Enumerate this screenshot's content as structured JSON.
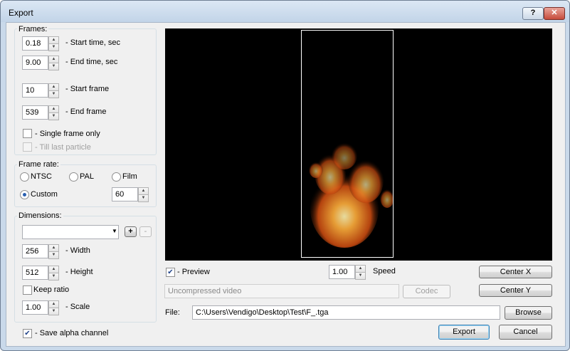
{
  "window": {
    "title": "Export",
    "help_label": "?",
    "close_label": "✕"
  },
  "frames": {
    "legend": "Frames:",
    "start_time": {
      "value": "0.18",
      "label": "- Start time, sec"
    },
    "end_time": {
      "value": "9.00",
      "label": "- End time, sec"
    },
    "start_frame": {
      "value": "10",
      "label": "- Start frame"
    },
    "end_frame": {
      "value": "539",
      "label": "- End frame"
    },
    "single_frame": {
      "label": "- Single frame only",
      "checked": false
    },
    "till_last": {
      "label": "- Till last particle",
      "checked": false,
      "disabled": true
    }
  },
  "frame_rate": {
    "legend": "Frame rate:",
    "options": [
      "NTSC",
      "PAL",
      "Film",
      "Custom"
    ],
    "selected": "Custom",
    "custom_value": "60"
  },
  "dimensions": {
    "legend": "Dimensions:",
    "preset_value": "",
    "add_label": "+",
    "remove_label": "-",
    "width": {
      "value": "256",
      "label": "- Width"
    },
    "height": {
      "value": "512",
      "label": "- Height"
    },
    "keep_ratio": {
      "label": "Keep ratio",
      "checked": false
    },
    "scale": {
      "value": "1.00",
      "label": "- Scale"
    }
  },
  "save_alpha": {
    "label": "- Save alpha channel",
    "checked": true
  },
  "preview": {
    "preview_label": "- Preview",
    "preview_checked": true,
    "speed_value": "1.00",
    "speed_label": "Speed",
    "center_x_label": "Center X",
    "center_y_label": "Center Y",
    "codec_value": "Uncompressed video",
    "codec_button": "Codec"
  },
  "file": {
    "label": "File:",
    "path": "C:\\Users\\Vendigo\\Desktop\\Test\\F_.tga",
    "browse_label": "Browse"
  },
  "actions": {
    "export_label": "Export",
    "cancel_label": "Cancel"
  },
  "icons": {
    "check": "check-mark-icon",
    "spin_up": "arrow-up-icon",
    "spin_down": "arrow-down-icon",
    "dropdown": "chevron-down-icon"
  },
  "colors": {
    "preview_bg": "#000000",
    "accent": "#3c7fb1"
  }
}
